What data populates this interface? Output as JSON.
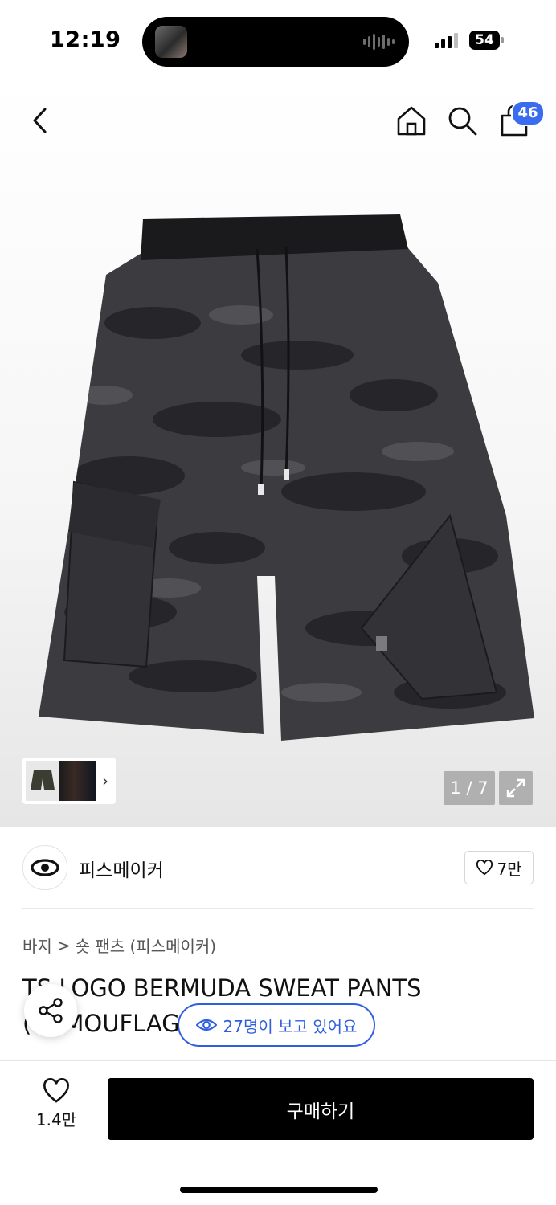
{
  "status": {
    "time": "12:19",
    "battery": "54"
  },
  "nav": {
    "cart_count": "46"
  },
  "gallery": {
    "counter": "1 / 7"
  },
  "brand": {
    "name": "피스메이커",
    "likes": "7만"
  },
  "breadcrumb": {
    "category": "바지",
    "separator": ">",
    "subcategory": "숏 팬츠 (피스메이커)"
  },
  "product": {
    "title": "TS LOGO BERMUDA SWEAT PANTS (CAMOUFLAGE)"
  },
  "viewers": {
    "text": "27명이 보고 있어요"
  },
  "bottom": {
    "wish_count": "1.4만",
    "buy_label": "구매하기"
  },
  "colors": {
    "accent": "#2f5fe0",
    "badge": "#3a6cf0",
    "buy_bg": "#000000"
  }
}
